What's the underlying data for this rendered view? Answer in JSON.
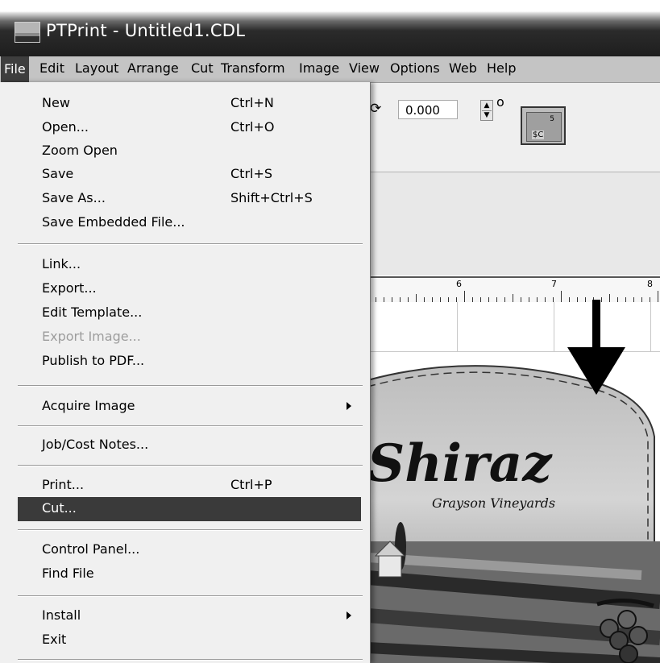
{
  "window": {
    "title": "PTPrint - Untitled1.CDL",
    "app_icon": "ptprint-app-icon"
  },
  "menubar": [
    "File",
    "Edit",
    "Layout",
    "Arrange",
    "Cut",
    "Transform",
    "Image",
    "View",
    "Options",
    "Web",
    "Help"
  ],
  "toolbar": {
    "rotation_value": "0.000",
    "rotation_unit": "o",
    "rotate_icon": "⟳",
    "sc_button": {
      "number": "5",
      "label": "$C"
    }
  },
  "ruler": {
    "numbers": [
      "6",
      "7",
      "8"
    ]
  },
  "label_art": {
    "title": "Shiraz",
    "subtitle": "Grayson Vineyards"
  },
  "file_menu": {
    "items": [
      {
        "label": "New",
        "shortcut": "Ctrl+N"
      },
      {
        "label": "Open...",
        "shortcut": "Ctrl+O"
      },
      {
        "label": "Zoom Open",
        "shortcut": ""
      },
      {
        "label": "Save",
        "shortcut": "Ctrl+S"
      },
      {
        "label": "Save As...",
        "shortcut": "Shift+Ctrl+S"
      },
      {
        "label": "Save Embedded File...",
        "shortcut": ""
      },
      {
        "label": "Link...",
        "shortcut": ""
      },
      {
        "label": "Export...",
        "shortcut": ""
      },
      {
        "label": "Edit Template...",
        "shortcut": ""
      },
      {
        "label": "Export Image...",
        "shortcut": "",
        "disabled": true
      },
      {
        "label": "Publish to PDF...",
        "shortcut": ""
      },
      {
        "label": "Acquire Image",
        "shortcut": "",
        "submenu": true
      },
      {
        "label": "Job/Cost Notes...",
        "shortcut": ""
      },
      {
        "label": "Print...",
        "shortcut": "Ctrl+P"
      },
      {
        "label": "Cut...",
        "shortcut": "",
        "highlighted": true
      },
      {
        "label": "Control Panel...",
        "shortcut": ""
      },
      {
        "label": "Find File",
        "shortcut": ""
      },
      {
        "label": "Install",
        "shortcut": "",
        "submenu": true
      },
      {
        "label": "Exit",
        "shortcut": ""
      }
    ]
  }
}
